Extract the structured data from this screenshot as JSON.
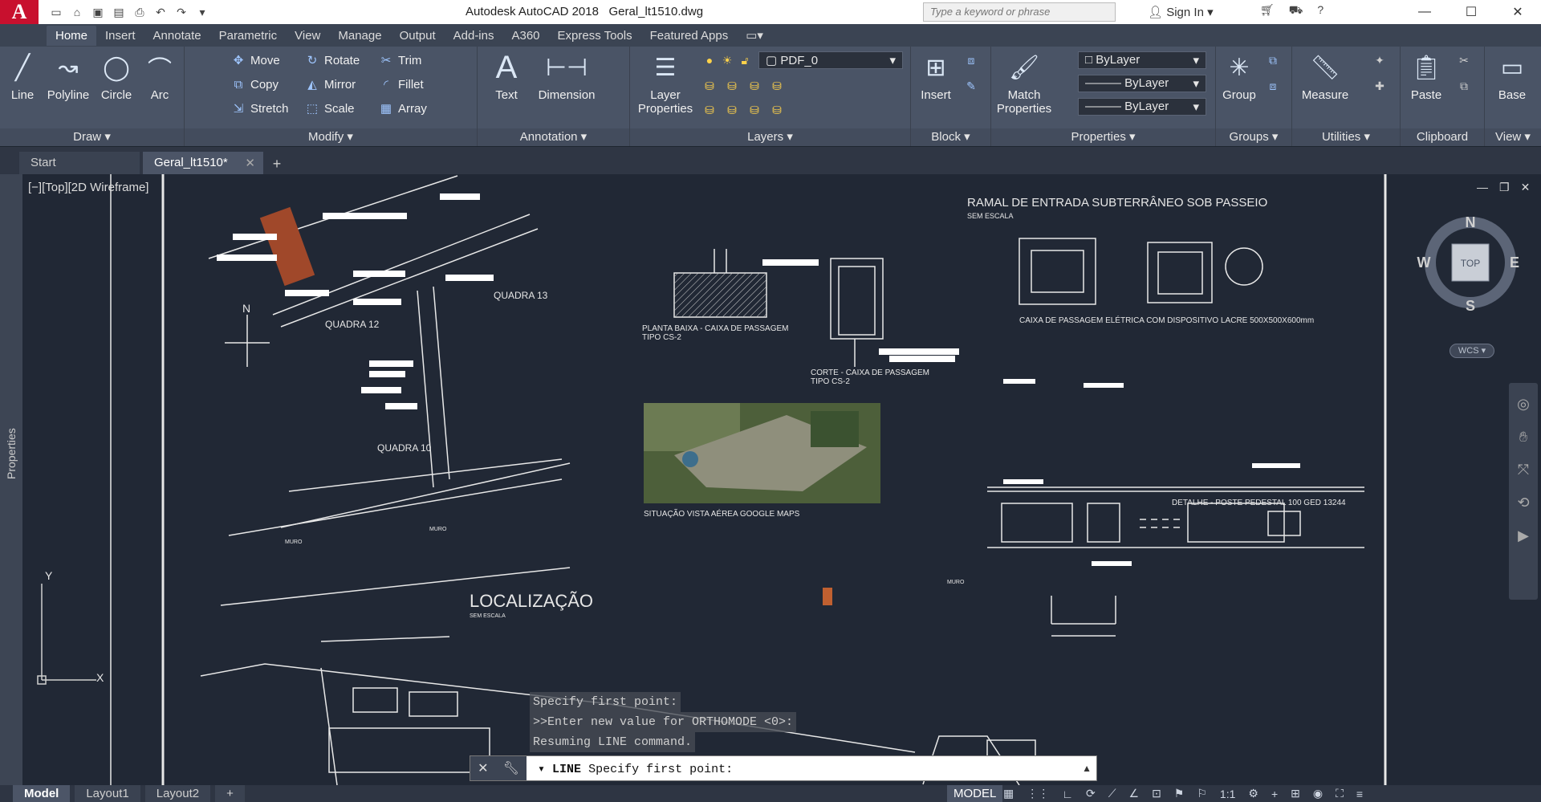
{
  "window": {
    "app_icon": "A",
    "title": "Autodesk AutoCAD 2018",
    "filename": "Geral_lt1510.dwg",
    "search_placeholder": "Type a keyword or phrase",
    "sign_in": "Sign In"
  },
  "ribbon_tabs": [
    "Home",
    "Insert",
    "Annotate",
    "Parametric",
    "View",
    "Manage",
    "Output",
    "Add-ins",
    "A360",
    "Express Tools",
    "Featured Apps"
  ],
  "ribbon": {
    "draw": {
      "title": "Draw",
      "line": "Line",
      "polyline": "Polyline",
      "circle": "Circle",
      "arc": "Arc"
    },
    "modify": {
      "title": "Modify",
      "move": "Move",
      "rotate": "Rotate",
      "trim": "Trim",
      "copy": "Copy",
      "mirror": "Mirror",
      "fillet": "Fillet",
      "stretch": "Stretch",
      "scale": "Scale",
      "array": "Array"
    },
    "annotation": {
      "title": "Annotation",
      "text": "Text",
      "dimension": "Dimension"
    },
    "layers": {
      "title": "Layers",
      "layer_properties_1": "Layer",
      "layer_properties_2": "Properties",
      "current_layer": "PDF_0"
    },
    "block": {
      "title": "Block",
      "insert": "Insert"
    },
    "properties": {
      "title": "Properties",
      "match_1": "Match",
      "match_2": "Properties",
      "color": "ByLayer",
      "linetype": "ByLayer",
      "lineweight": "ByLayer"
    },
    "groups": {
      "title": "Groups",
      "group": "Group"
    },
    "utilities": {
      "title": "Utilities",
      "measure": "Measure"
    },
    "clipboard": {
      "title": "Clipboard",
      "paste": "Paste"
    },
    "view": {
      "title": "View",
      "base": "Base"
    }
  },
  "doc_tabs": {
    "start": "Start",
    "active": "Geral_lt1510*"
  },
  "viewport": {
    "label": "[−][Top][2D Wireframe]",
    "properties": "Properties",
    "viewcube": {
      "n": "N",
      "s": "S",
      "e": "E",
      "w": "W",
      "top": "TOP",
      "wcs": "WCS"
    }
  },
  "drawing": {
    "localizacao": "LOCALIZAÇÃO",
    "sem_escala": "SEM ESCALA",
    "quadra_12": "QUADRA 12",
    "quadra_13": "QUADRA 13",
    "quadra_10": "QUADRA 10",
    "north": "N",
    "ramal": "RAMAL DE ENTRADA SUBTERRÂNEO SOB PASSEIO",
    "planta_1": "PLANTA BAIXA - CAIXA DE PASSAGEM",
    "planta_2": "TIPO CS-2",
    "corte_1": "CORTE - CAIXA DE PASSAGEM",
    "corte_2": "TIPO CS-2",
    "caixa": "CAIXA DE PASSAGEM ELÉTRICA COM DISPOSITIVO LACRE 500X500X600mm",
    "situacao": "SITUAÇÃO VISTA AÉREA GOOGLE MAPS",
    "detalhe": "DETALHE - POSTE PEDESTAL 100 GED 13244",
    "muro": "MURO",
    "y_axis": "Y",
    "x_axis": "X"
  },
  "command": {
    "history": [
      "Specify first point:",
      ">>Enter new value for ORTHOMODE <0>:",
      "Resuming LINE command."
    ],
    "current_cmd": "LINE",
    "current_prompt": "Specify first point:"
  },
  "layout_tabs": [
    "Model",
    "Layout1",
    "Layout2"
  ],
  "status": {
    "model": "MODEL",
    "scale": "1:1"
  },
  "colors": {
    "ribbon_bg": "#4a5466",
    "canvas_bg": "#212835",
    "autocad_red": "#c8102e"
  }
}
